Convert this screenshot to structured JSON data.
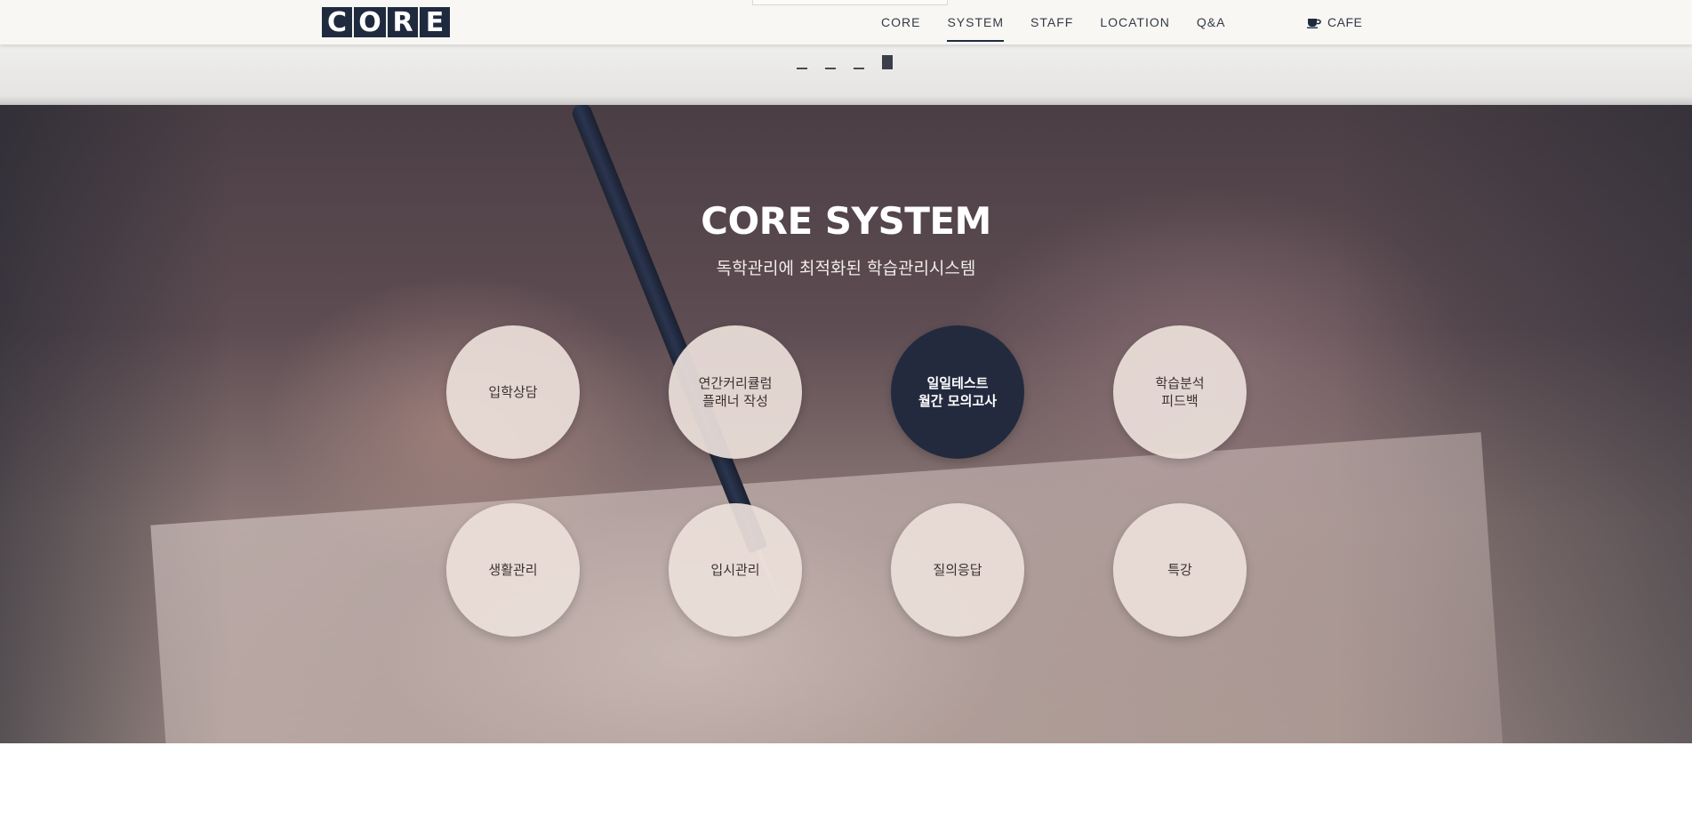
{
  "header": {
    "logo_letters": [
      "C",
      "O",
      "R",
      "E"
    ],
    "nav": [
      {
        "label": "CORE"
      },
      {
        "label": "SYSTEM"
      },
      {
        "label": "STAFF"
      },
      {
        "label": "LOCATION"
      },
      {
        "label": "Q&A"
      }
    ],
    "active_nav": "SYSTEM",
    "cafe_label": "CAFE",
    "cafe_icon": "coffee-cup-icon"
  },
  "pager": {
    "count": 4,
    "active_index": 3
  },
  "hero": {
    "title": "CORE SYSTEM",
    "subtitle": "독학관리에 최적화된 학습관리시스템",
    "circles": [
      {
        "label": "입학상담"
      },
      {
        "label": "연간커리큘럼\n플래너 작성"
      },
      {
        "label": "일일테스트\n월간 모의고사",
        "active": true
      },
      {
        "label": "학습분석\n피드백"
      },
      {
        "label": "생활관리"
      },
      {
        "label": "입시관리"
      },
      {
        "label": "질의응답"
      },
      {
        "label": "특강"
      }
    ]
  },
  "colors": {
    "brand_navy": "#1f2a3f",
    "active_circle": "#232a3e",
    "circle_fill": "#ece0da"
  }
}
